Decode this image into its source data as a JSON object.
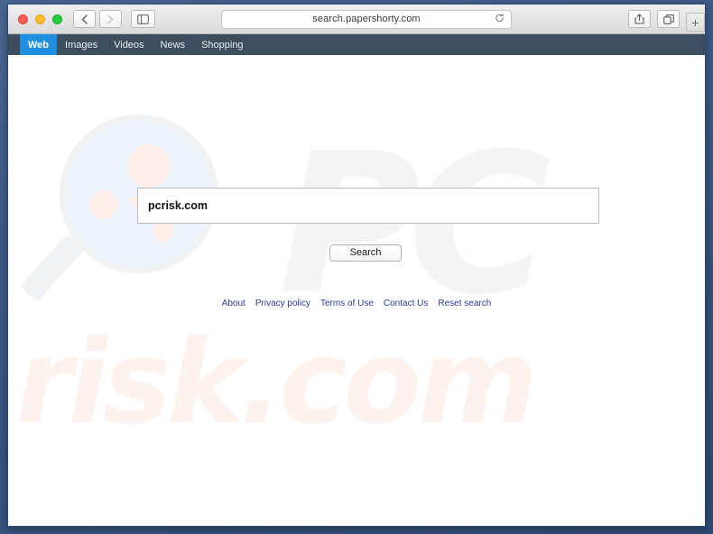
{
  "browser": {
    "traffic_lights": [
      {
        "name": "close",
        "color": "#ff5f57"
      },
      {
        "name": "minimize",
        "color": "#ffbd2e"
      },
      {
        "name": "maximize",
        "color": "#28c940"
      }
    ],
    "back_label": "‹",
    "forward_label": "›",
    "sidebar_icon": "sidebar-icon",
    "url": "search.papershorty.com",
    "reload_label": "↻",
    "share_icon": "share-icon",
    "tabs_icon": "tabs-icon",
    "new_tab_label": "+"
  },
  "site_nav": {
    "items": [
      {
        "label": "Web",
        "active": true
      },
      {
        "label": "Images",
        "active": false
      },
      {
        "label": "Videos",
        "active": false
      },
      {
        "label": "News",
        "active": false
      },
      {
        "label": "Shopping",
        "active": false
      }
    ],
    "active_color": "#1e8fe0",
    "bar_color": "#3e4e5e"
  },
  "search": {
    "value": "pcrisk.com",
    "placeholder": "",
    "button_label": "Search"
  },
  "footer": {
    "links": [
      "About",
      "Privacy policy",
      "Terms of Use",
      "Contact Us",
      "Reset search"
    ],
    "link_color": "#2b3b8f"
  },
  "watermarks": {
    "pc_text": "PC",
    "risk_text": "risk.com",
    "magnifier_icon": "magnifier-watermark",
    "pc_color": "#f4f4f5",
    "risk_color": "#fdf3ee"
  }
}
